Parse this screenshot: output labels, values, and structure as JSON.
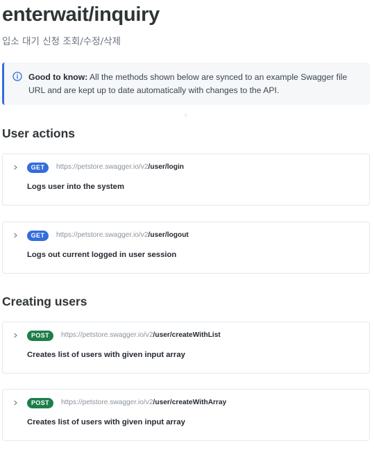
{
  "header": {
    "title": "enterwait/inquiry",
    "subtitle": "입소 대기 신청 조회/수정/삭제"
  },
  "hint": {
    "icon": "info-icon",
    "label": "Good to know:",
    "text": "All the methods shown below are synced to an example Swagger file URL and are kept up to date automatically with changes to the API."
  },
  "sections": [
    {
      "title": "User actions",
      "endpoints": [
        {
          "method": "GET",
          "base": "https://petstore.swagger.io/v2",
          "path": "/user/login",
          "description": "Logs user into the system"
        },
        {
          "method": "GET",
          "base": "https://petstore.swagger.io/v2",
          "path": "/user/logout",
          "description": "Logs out current logged in user session"
        }
      ]
    },
    {
      "title": "Creating users",
      "endpoints": [
        {
          "method": "POST",
          "base": "https://petstore.swagger.io/v2",
          "path": "/user/createWithList",
          "description": "Creates list of users with given input array"
        },
        {
          "method": "POST",
          "base": "https://petstore.swagger.io/v2",
          "path": "/user/createWithArray",
          "description": "Creates list of users with given input array"
        }
      ]
    }
  ],
  "colors": {
    "get_badge": "#346ddb",
    "post_badge": "#1e7e4a",
    "hint_accent": "#346ddb",
    "hint_background": "#f5f7f9"
  }
}
